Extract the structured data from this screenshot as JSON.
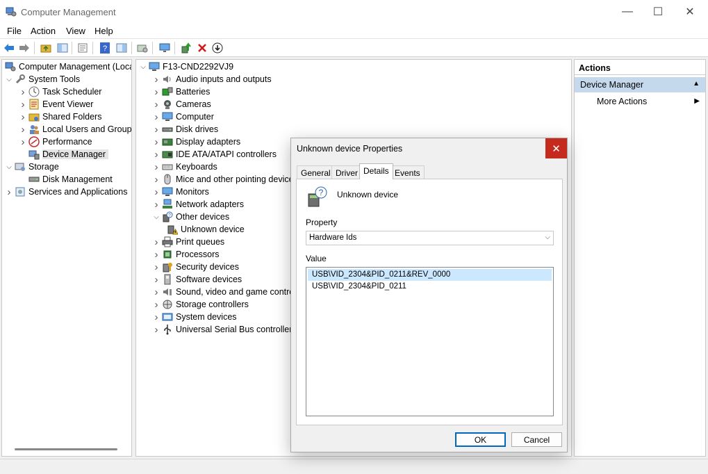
{
  "window": {
    "title": "Computer Management",
    "minimize": "—",
    "maximize": "☐",
    "close": "✕"
  },
  "menu": [
    "File",
    "Action",
    "View",
    "Help"
  ],
  "left_tree": [
    {
      "label": "Computer Management (Local",
      "level": 0,
      "expander": "",
      "icon": "computer-management-icon"
    },
    {
      "label": "System Tools",
      "level": 1,
      "expander": "v",
      "icon": "system-tools-icon"
    },
    {
      "label": "Task Scheduler",
      "level": 2,
      "expander": ">",
      "icon": "task-scheduler-icon"
    },
    {
      "label": "Event Viewer",
      "level": 2,
      "expander": ">",
      "icon": "event-viewer-icon"
    },
    {
      "label": "Shared Folders",
      "level": 2,
      "expander": ">",
      "icon": "shared-folders-icon"
    },
    {
      "label": "Local Users and Groups",
      "level": 2,
      "expander": ">",
      "icon": "users-icon"
    },
    {
      "label": "Performance",
      "level": 2,
      "expander": ">",
      "icon": "performance-icon"
    },
    {
      "label": "Device Manager",
      "level": 2,
      "expander": "",
      "icon": "device-manager-icon",
      "selected": true
    },
    {
      "label": "Storage",
      "level": 1,
      "expander": "v",
      "icon": "storage-icon"
    },
    {
      "label": "Disk Management",
      "level": 2,
      "expander": "",
      "icon": "disk-management-icon"
    },
    {
      "label": "Services and Applications",
      "level": 1,
      "expander": ">",
      "icon": "services-icon"
    }
  ],
  "device_tree": {
    "root": "F13-CND2292VJ9",
    "items": [
      {
        "label": "Audio inputs and outputs",
        "icon": "audio-icon"
      },
      {
        "label": "Batteries",
        "icon": "battery-icon"
      },
      {
        "label": "Cameras",
        "icon": "camera-icon"
      },
      {
        "label": "Computer",
        "icon": "monitor-icon"
      },
      {
        "label": "Disk drives",
        "icon": "disk-drive-icon"
      },
      {
        "label": "Display adapters",
        "icon": "display-adapter-icon"
      },
      {
        "label": "IDE ATA/ATAPI controllers",
        "icon": "ide-controller-icon"
      },
      {
        "label": "Keyboards",
        "icon": "keyboard-icon"
      },
      {
        "label": "Mice and other pointing devices",
        "icon": "mouse-icon"
      },
      {
        "label": "Monitors",
        "icon": "monitor-icon"
      },
      {
        "label": "Network adapters",
        "icon": "network-adapter-icon"
      },
      {
        "label": "Other devices",
        "icon": "other-devices-icon",
        "expanded": true
      },
      {
        "label": "Unknown device",
        "icon": "unknown-device-warning-icon",
        "child": true
      },
      {
        "label": "Print queues",
        "icon": "printer-icon"
      },
      {
        "label": "Processors",
        "icon": "processor-icon"
      },
      {
        "label": "Security devices",
        "icon": "security-device-icon"
      },
      {
        "label": "Software devices",
        "icon": "software-device-icon"
      },
      {
        "label": "Sound, video and game controllers",
        "icon": "sound-icon"
      },
      {
        "label": "Storage controllers",
        "icon": "storage-controller-icon"
      },
      {
        "label": "System devices",
        "icon": "system-devices-icon"
      },
      {
        "label": "Universal Serial Bus controllers",
        "icon": "usb-icon"
      }
    ]
  },
  "actions": {
    "header": "Actions",
    "section": "Device Manager",
    "more": "More Actions"
  },
  "dialog": {
    "title": "Unknown device Properties",
    "tabs": [
      "General",
      "Driver",
      "Details",
      "Events"
    ],
    "active_tab": "Details",
    "device_name": "Unknown device",
    "property_label": "Property",
    "property_value": "Hardware Ids",
    "value_label": "Value",
    "values": [
      "USB\\VID_2304&PID_0211&REV_0000",
      "USB\\VID_2304&PID_0211"
    ],
    "ok": "OK",
    "cancel": "Cancel"
  },
  "colors": {
    "accent": "#0067c0",
    "selection": "#cce8ff",
    "close_red": "#c42b1c",
    "actions_section": "#c5d9ec"
  }
}
